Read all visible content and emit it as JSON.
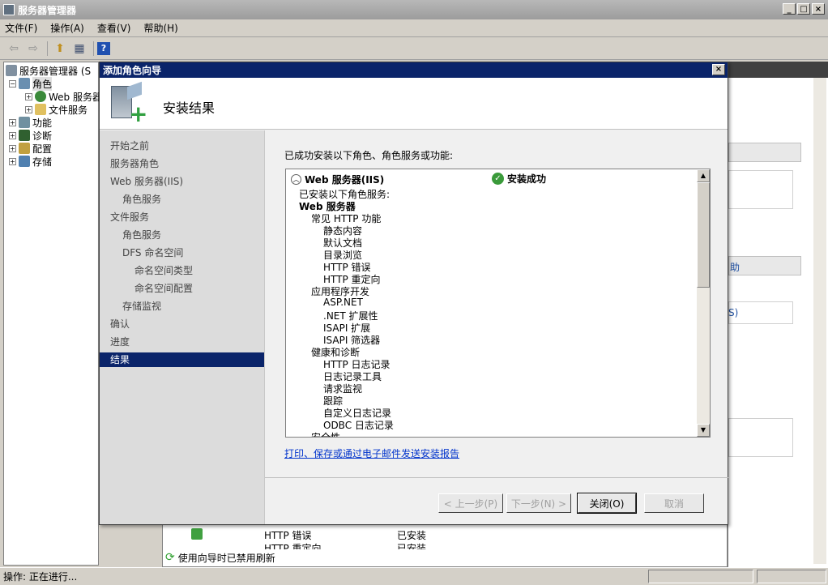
{
  "app": {
    "title": "服务器管理器",
    "window_buttons": [
      "_",
      "□",
      "×"
    ]
  },
  "menu": [
    "文件(F)",
    "操作(A)",
    "查看(V)",
    "帮助(H)"
  ],
  "toolbar": {
    "back": "⇦",
    "forward": "⇨",
    "up": "⬆",
    "view": "▦",
    "help": "?"
  },
  "tree": [
    {
      "label": "服务器管理器 (S",
      "indent": 0
    },
    {
      "label": "角色",
      "indent": 1,
      "expander": "−"
    },
    {
      "label": "Web 服务器",
      "indent": 2,
      "expander": "+"
    },
    {
      "label": "文件服务",
      "indent": 2,
      "expander": "+"
    },
    {
      "label": "功能",
      "indent": 1,
      "expander": "+"
    },
    {
      "label": "诊断",
      "indent": 1,
      "expander": "+"
    },
    {
      "label": "配置",
      "indent": 1,
      "expander": "+"
    },
    {
      "label": "存储",
      "indent": 1,
      "expander": "+"
    }
  ],
  "background": {
    "right_help": "助",
    "right_s": "S)",
    "rows": [
      {
        "name": "HTTP 错误",
        "status": "已安装"
      },
      {
        "name": "HTTP 重定向",
        "status": "已安装"
      }
    ],
    "refresh_notice": "使用向导时已禁用刷新"
  },
  "status": "操作:  正在进行...",
  "dialog": {
    "title": "添加角色向导",
    "close": "×",
    "header": "安装结果",
    "nav": [
      {
        "label": "开始之前",
        "level": 0,
        "selected": false
      },
      {
        "label": "服务器角色",
        "level": 0,
        "selected": false
      },
      {
        "label": "Web 服务器(IIS)",
        "level": 0,
        "selected": false
      },
      {
        "label": "角色服务",
        "level": 1,
        "selected": false
      },
      {
        "label": "文件服务",
        "level": 0,
        "selected": false
      },
      {
        "label": "角色服务",
        "level": 1,
        "selected": false
      },
      {
        "label": "DFS 命名空间",
        "level": 1,
        "selected": false
      },
      {
        "label": "命名空间类型",
        "level": 2,
        "selected": false
      },
      {
        "label": "命名空间配置",
        "level": 2,
        "selected": false
      },
      {
        "label": "存储监视",
        "level": 1,
        "selected": false
      },
      {
        "label": "确认",
        "level": 0,
        "selected": false
      },
      {
        "label": "进度",
        "level": 0,
        "selected": false
      },
      {
        "label": "结果",
        "level": 0,
        "selected": true
      }
    ],
    "intro": "已成功安装以下角色、角色服务或功能:",
    "result_header": {
      "name": "Web 服务器(IIS)",
      "status": "安装成功"
    },
    "result_lines": [
      {
        "text": "已安装以下角色服务:",
        "level": 0,
        "bold": false
      },
      {
        "text": "Web 服务器",
        "level": 0,
        "bold": true
      },
      {
        "text": "常见 HTTP 功能",
        "level": 1,
        "bold": false
      },
      {
        "text": "静态内容",
        "level": 2,
        "bold": false
      },
      {
        "text": "默认文档",
        "level": 2,
        "bold": false
      },
      {
        "text": "目录浏览",
        "level": 2,
        "bold": false
      },
      {
        "text": "HTTP 错误",
        "level": 2,
        "bold": false
      },
      {
        "text": "HTTP 重定向",
        "level": 2,
        "bold": false
      },
      {
        "text": "应用程序开发",
        "level": 1,
        "bold": false
      },
      {
        "text": "ASP.NET",
        "level": 2,
        "bold": false
      },
      {
        "text": ".NET 扩展性",
        "level": 2,
        "bold": false
      },
      {
        "text": "ISAPI 扩展",
        "level": 2,
        "bold": false
      },
      {
        "text": "ISAPI 筛选器",
        "level": 2,
        "bold": false
      },
      {
        "text": "健康和诊断",
        "level": 1,
        "bold": false
      },
      {
        "text": "HTTP 日志记录",
        "level": 2,
        "bold": false
      },
      {
        "text": "日志记录工具",
        "level": 2,
        "bold": false
      },
      {
        "text": "请求监视",
        "level": 2,
        "bold": false
      },
      {
        "text": "跟踪",
        "level": 2,
        "bold": false
      },
      {
        "text": "自定义日志记录",
        "level": 2,
        "bold": false
      },
      {
        "text": "ODBC 日志记录",
        "level": 2,
        "bold": false
      },
      {
        "text": "安全性",
        "level": 1,
        "bold": false
      }
    ],
    "report_link": "打印、保存或通过电子邮件发送安装报告",
    "buttons": {
      "prev": "< 上一步(P)",
      "next": "下一步(N) >",
      "close": "关闭(O)",
      "cancel": "取消"
    }
  }
}
